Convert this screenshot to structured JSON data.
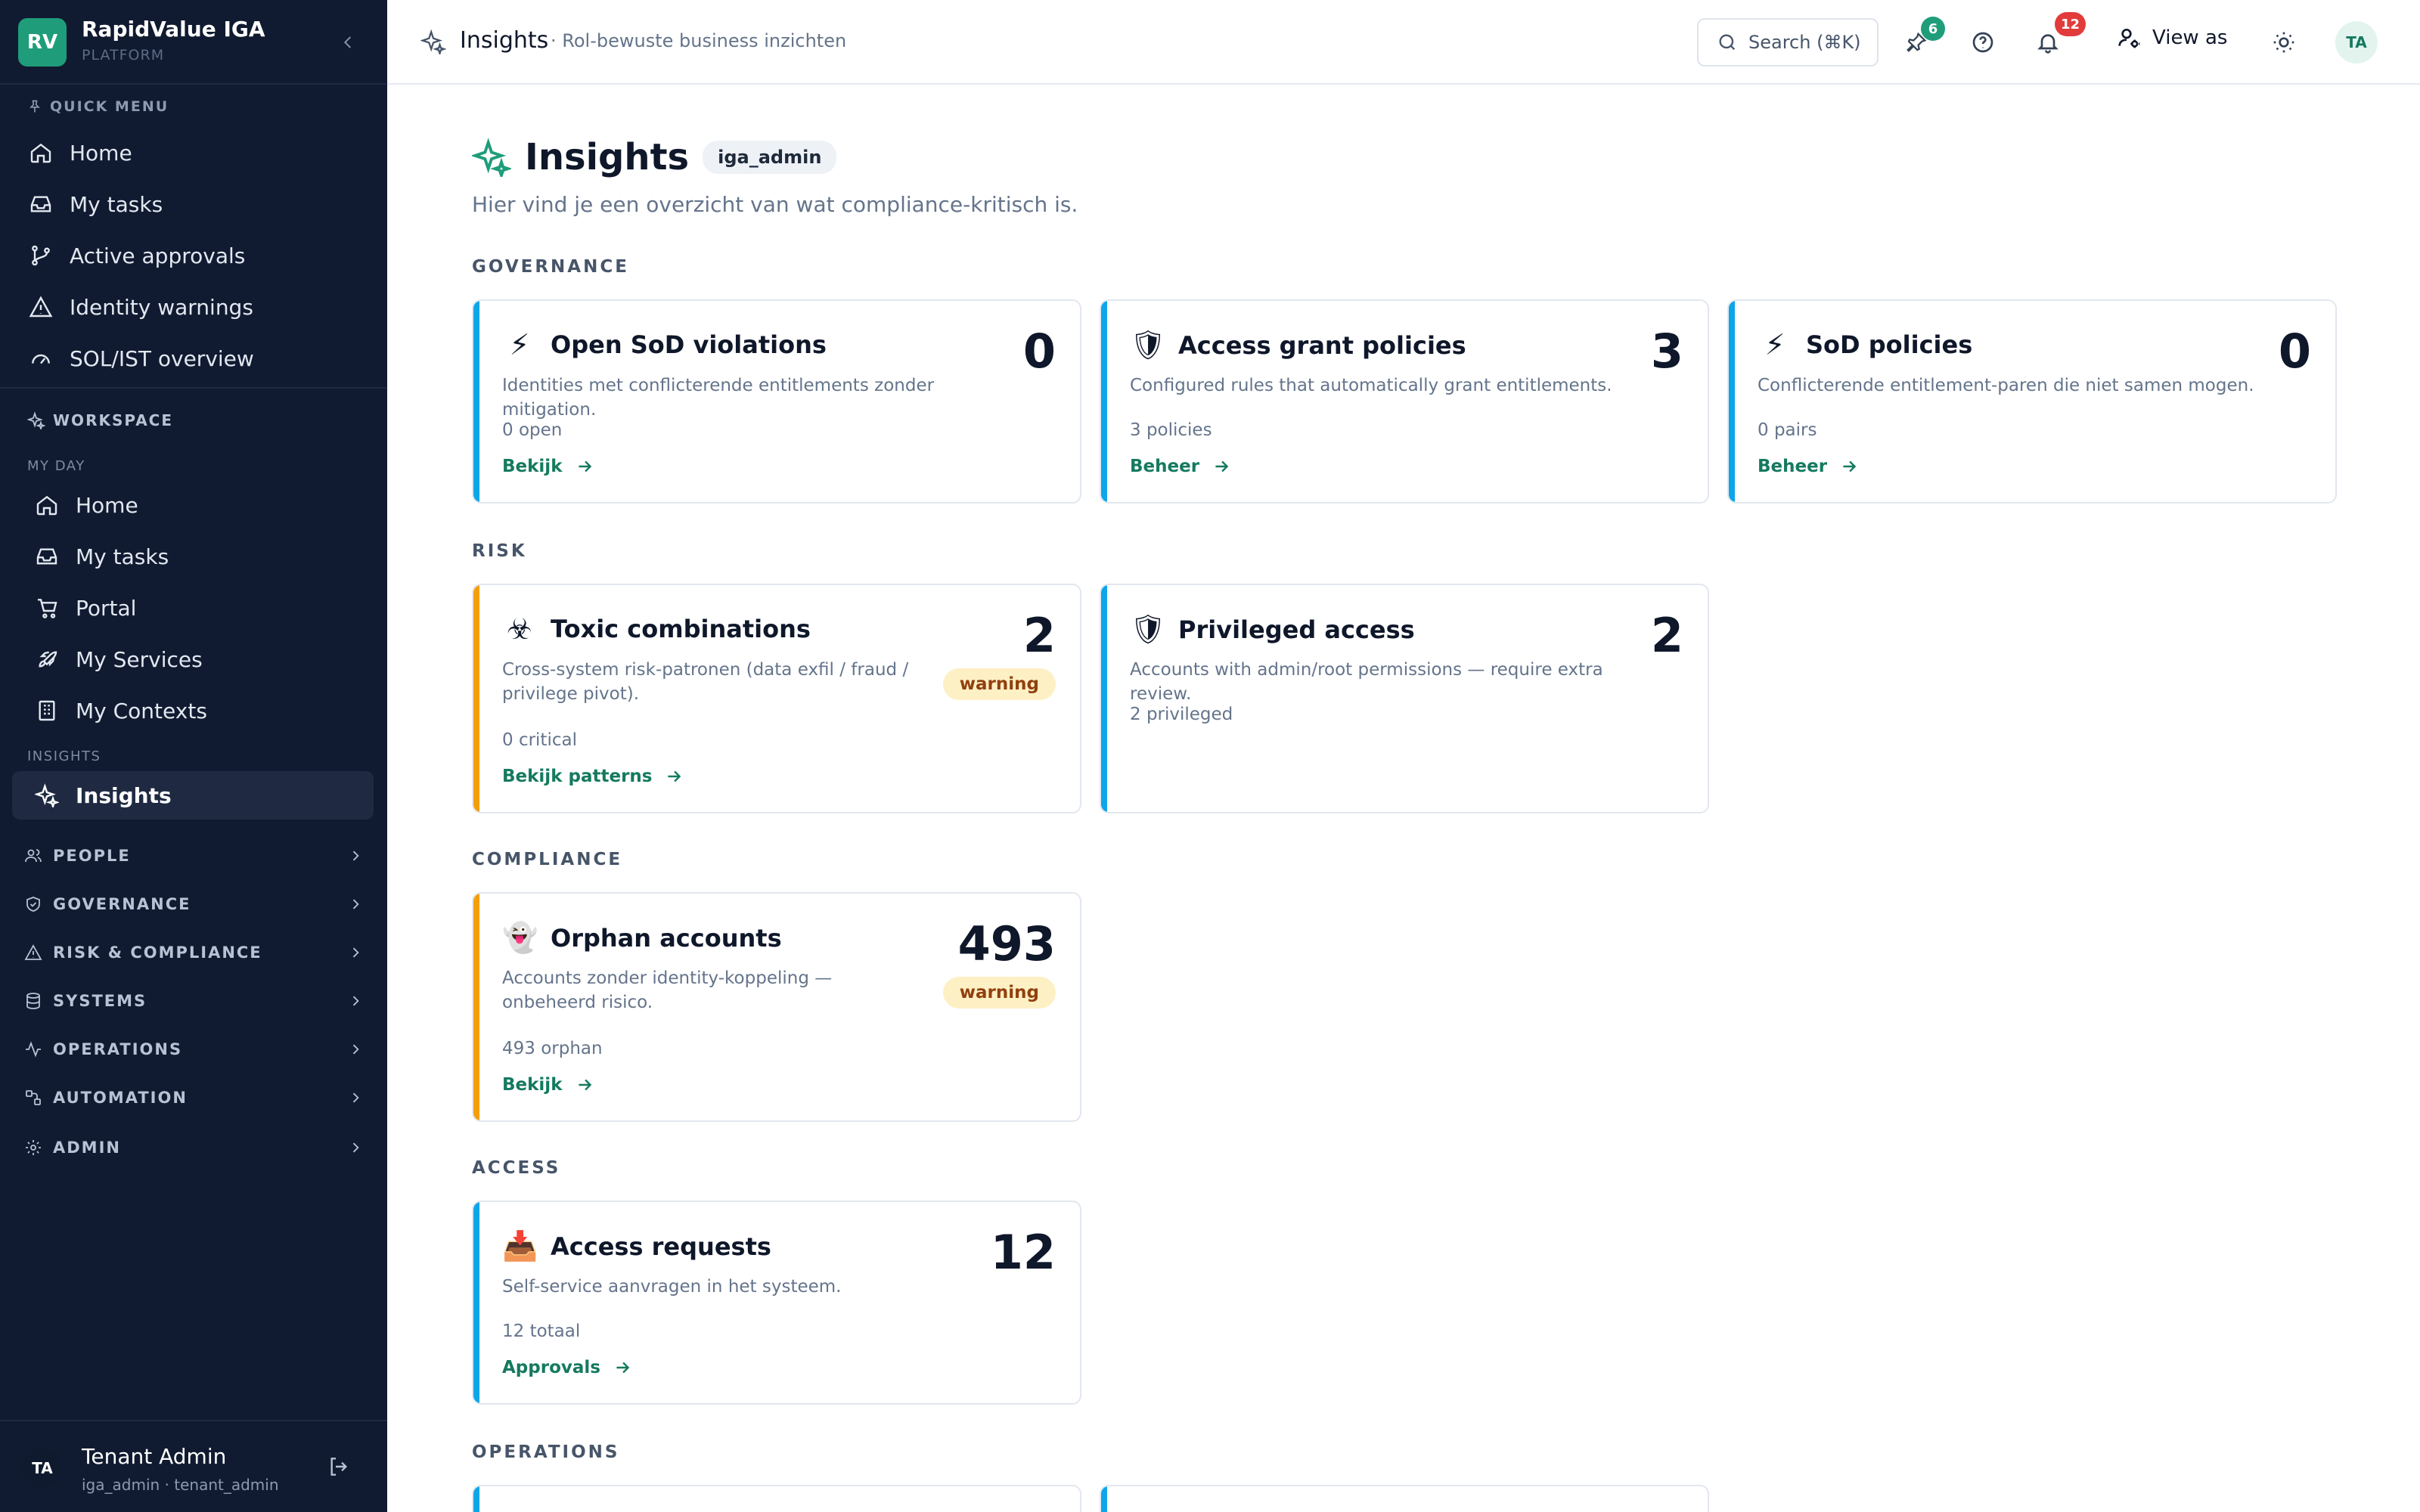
{
  "brand": {
    "logo": "RV",
    "name": "RapidValue IGA",
    "sub": "PLATFORM"
  },
  "sidebar": {
    "quick_menu_label": "QUICK MENU",
    "quick_items": [
      {
        "label": "Home",
        "icon": "home-icon"
      },
      {
        "label": "My tasks",
        "icon": "inbox-icon"
      },
      {
        "label": "Active approvals",
        "icon": "git-branch-icon"
      },
      {
        "label": "Identity warnings",
        "icon": "warning-icon"
      },
      {
        "label": "SOL/IST overview",
        "icon": "gauge-icon"
      }
    ],
    "workspace_label": "WORKSPACE",
    "my_day_label": "MY DAY",
    "my_day_items": [
      {
        "label": "Home",
        "icon": "home-icon"
      },
      {
        "label": "My tasks",
        "icon": "inbox-icon"
      },
      {
        "label": "Portal",
        "icon": "cart-icon"
      },
      {
        "label": "My Services",
        "icon": "rocket-icon"
      },
      {
        "label": "My Contexts",
        "icon": "building-icon"
      }
    ],
    "insights_label": "INSIGHTS",
    "insights_item": "Insights",
    "groups": [
      {
        "label": "PEOPLE",
        "icon": "users-icon"
      },
      {
        "label": "GOVERNANCE",
        "icon": "shield-check-icon"
      },
      {
        "label": "RISK & COMPLIANCE",
        "icon": "warning-icon"
      },
      {
        "label": "SYSTEMS",
        "icon": "database-icon"
      },
      {
        "label": "OPERATIONS",
        "icon": "activity-icon"
      },
      {
        "label": "AUTOMATION",
        "icon": "workflow-icon"
      },
      {
        "label": "ADMIN",
        "icon": "gear-icon"
      }
    ],
    "user": {
      "initials": "TA",
      "name": "Tenant Admin",
      "role": "iga_admin · tenant_admin"
    }
  },
  "topbar": {
    "title": "Insights",
    "subtitle": "· Rol-bewuste business inzichten",
    "search": "Search (⌘K)",
    "pin_badge": "6",
    "notif_badge": "12",
    "view_as": "View as",
    "avatar": "TA"
  },
  "page": {
    "title": "Insights",
    "role": "iga_admin",
    "description": "Hier vind je een overzicht van wat compliance-kritisch is."
  },
  "categories": {
    "governance": "GOVERNANCE",
    "risk": "RISK",
    "compliance": "COMPLIANCE",
    "access": "ACCESS",
    "operations": "OPERATIONS"
  },
  "cards": {
    "sod_violations": {
      "emoji": "⚡",
      "title": "Open SoD violations",
      "desc": "Identities met conflicterende entitlements zonder mitigation.",
      "count": "0",
      "meta": "0 open",
      "link": "Bekijk"
    },
    "grant_policies": {
      "emoji": "🛡",
      "title": "Access grant policies",
      "desc": "Configured rules that automatically grant entitlements.",
      "count": "3",
      "meta": "3 policies",
      "link": "Beheer"
    },
    "sod_policies": {
      "emoji": "⚡",
      "title": "SoD policies",
      "desc": "Conflicterende entitlement-paren die niet samen mogen.",
      "count": "0",
      "meta": "0 pairs",
      "link": "Beheer"
    },
    "toxic": {
      "emoji": "☣",
      "title": "Toxic combinations",
      "desc": "Cross-system risk-patronen (data exfil / fraud / privilege pivot).",
      "count": "2",
      "pill": "warning",
      "meta": "0 critical",
      "link": "Bekijk patterns"
    },
    "privileged": {
      "emoji": "🛡",
      "title": "Privileged access",
      "desc": "Accounts with admin/root permissions — require extra review.",
      "count": "2",
      "meta": "2 privileged"
    },
    "orphan": {
      "emoji": "👻",
      "title": "Orphan accounts",
      "desc": "Accounts zonder identity-koppeling — onbeheerd risico.",
      "count": "493",
      "pill": "warning",
      "meta": "493 orphan",
      "link": "Bekijk"
    },
    "requests": {
      "emoji": "📥",
      "title": "Access requests",
      "desc": "Self-service aanvragen in het systeem.",
      "count": "12",
      "meta": "12 totaal",
      "link": "Approvals"
    }
  },
  "colors": {
    "accent": "#1f9d7a",
    "sidebar_bg": "#101a30",
    "info_bar": "#0ea5e9",
    "warn_bar": "#f59e0b"
  }
}
